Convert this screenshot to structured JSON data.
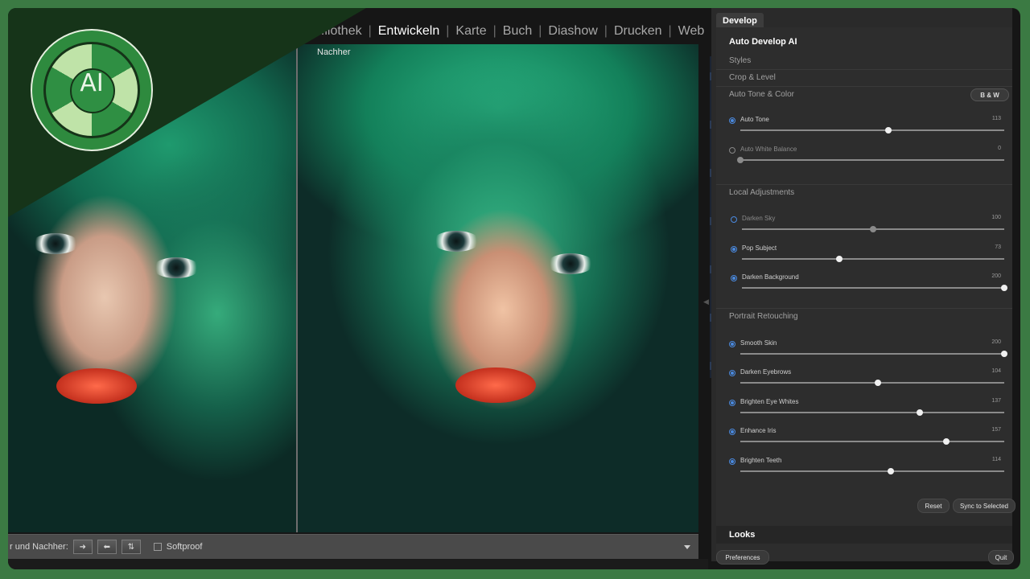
{
  "nav": {
    "items": [
      "...liothek",
      "Entwickeln",
      "Karte",
      "Buch",
      "Diashow",
      "Drucken",
      "Web"
    ],
    "active": "Entwickeln"
  },
  "view": {
    "after_label": "Nachher"
  },
  "toolbar": {
    "compare_label": "r und Nachher:",
    "softproof_label": "Softproof"
  },
  "logo": {
    "text": "AI"
  },
  "panel": {
    "tab": "Develop",
    "title": "Auto Develop AI",
    "items": [
      "Styles",
      "Crop & Level",
      "Auto Tone & Color"
    ],
    "bw_button": "B & W",
    "auto_tone": {
      "label": "Auto Tone",
      "value": "113",
      "fraction": 0.56,
      "on": true
    },
    "auto_wb": {
      "label": "Auto White Balance",
      "value": "0",
      "fraction": 0.0,
      "on": false
    },
    "local_title": "Local Adjustments",
    "local": [
      {
        "label": "Darken Sky",
        "value": "100",
        "fraction": 0.5,
        "on": false
      },
      {
        "label": "Pop Subject",
        "value": "73",
        "fraction": 0.37,
        "on": true
      },
      {
        "label": "Darken Background",
        "value": "200",
        "fraction": 1.0,
        "on": true
      }
    ],
    "portrait_title": "Portrait Retouching",
    "portrait": [
      {
        "label": "Smooth Skin",
        "value": "200",
        "fraction": 1.0
      },
      {
        "label": "Darken Eyebrows",
        "value": "104",
        "fraction": 0.52
      },
      {
        "label": "Brighten Eye Whites",
        "value": "137",
        "fraction": 0.68
      },
      {
        "label": "Enhance Iris",
        "value": "157",
        "fraction": 0.78
      },
      {
        "label": "Brighten Teeth",
        "value": "114",
        "fraction": 0.57
      }
    ],
    "reset": "Reset",
    "sync": "Sync to Selected",
    "looks": "Looks",
    "preferences": "Preferences",
    "quit": "Quit"
  }
}
